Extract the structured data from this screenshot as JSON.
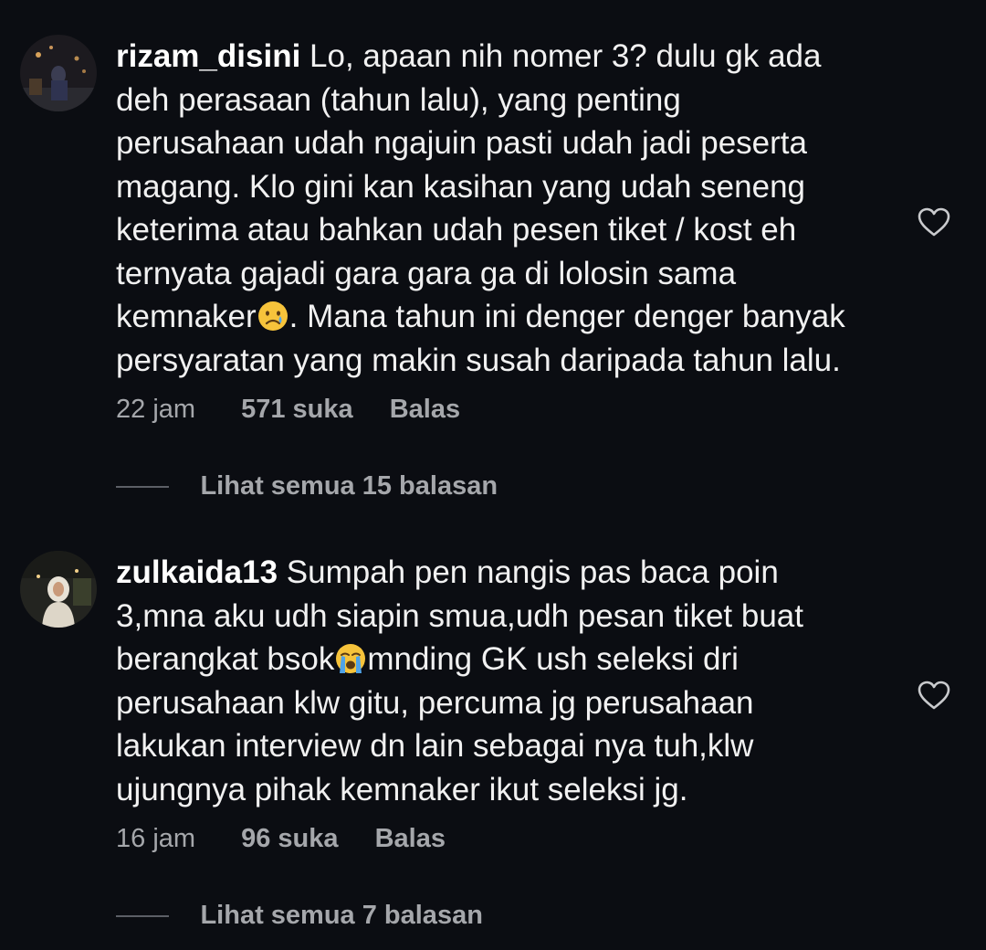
{
  "comments": [
    {
      "username": "rizam_disini",
      "lines": [
        "Lo, apaan nih nomer 3? dulu gk ada",
        "deh perasaan (tahun lalu), yang penting",
        "perusahaan udah ngajuin pasti udah jadi peserta",
        "magang. Klo gini kan kasihan yang udah seneng",
        "keterima atau bahkan udah pesen tiket / kost eh",
        "ternyata gajadi gara gara ga di lolosin sama"
      ],
      "emoji_line_before": "kemnaker",
      "emoji_line_after": ". Mana tahun ini denger denger banyak",
      "last_line": "persyaratan yang makin susah daripada tahun lalu.",
      "emoji": "crying-face-emoji",
      "time": "22 jam",
      "likes": "571 suka",
      "reply": "Balas",
      "view_replies": "Lihat semua 15 balasan"
    },
    {
      "username": "zulkaida13",
      "first_line": "Sumpah pen nangis pas baca poin",
      "line2": "3,mna aku udh siapin smua,udh pesan tiket buat",
      "emoji_line_before": "berangkat bsok",
      "emoji_line_after": "mnding GK ush seleksi dri",
      "lines_after": [
        "perusahaan klw gitu, percuma jg perusahaan",
        "lakukan interview dn lain sebagai nya tuh,klw",
        "ujungnya pihak kemnaker ikut seleksi jg."
      ],
      "emoji": "loudly-crying-face-emoji",
      "time": "16 jam",
      "likes": "96 suka",
      "reply": "Balas",
      "view_replies": "Lihat semua 7 balasan"
    }
  ],
  "colors": {
    "background": "#0b0d12",
    "text": "#f1f1f1",
    "muted": "#a5a7ab"
  }
}
